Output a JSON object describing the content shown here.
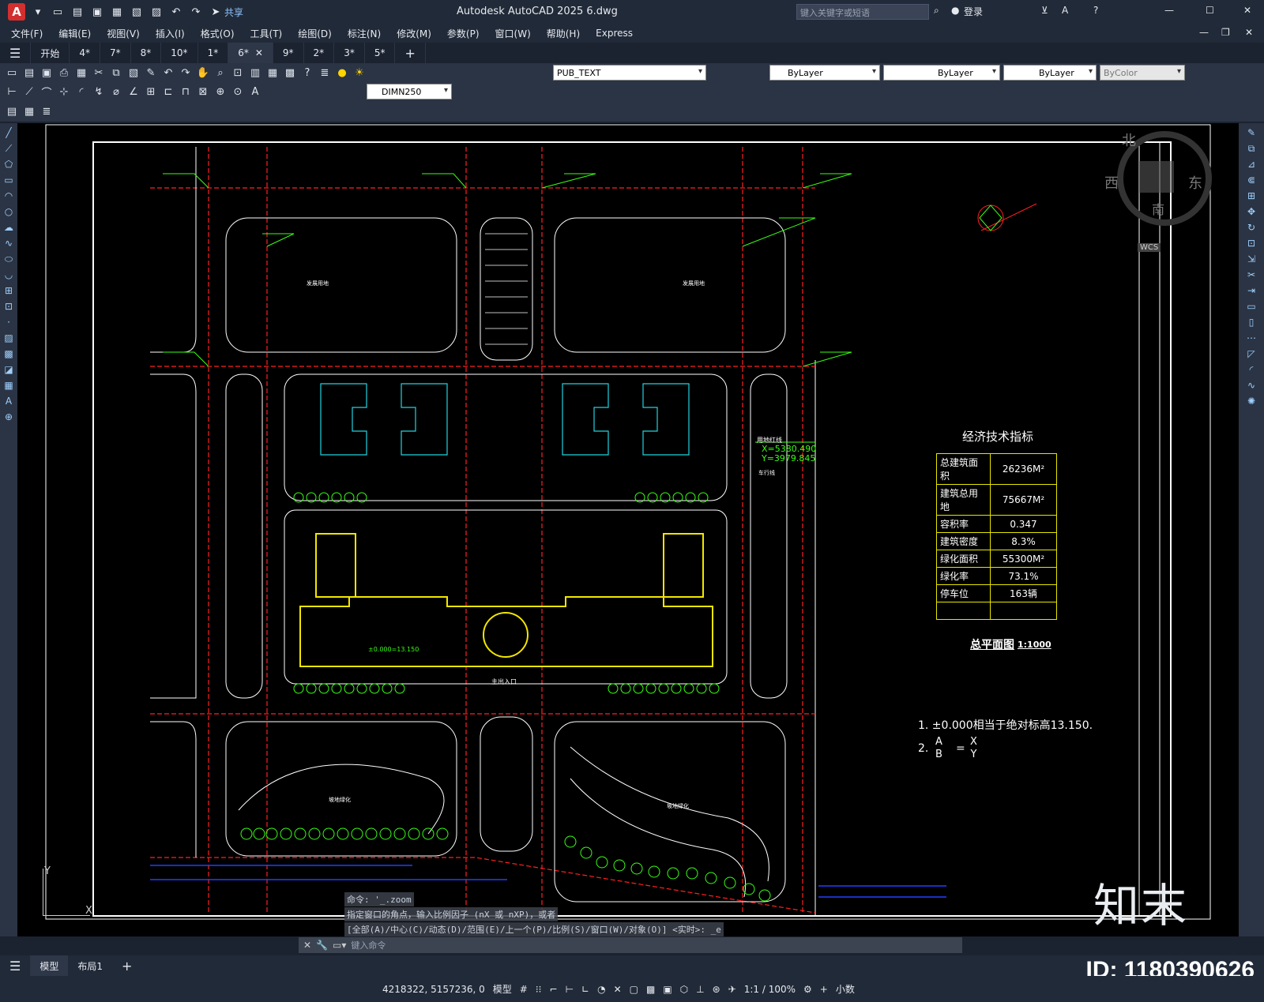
{
  "titlebar": {
    "logo": "A",
    "share": "共享",
    "title": "Autodesk AutoCAD 2025    6.dwg",
    "search_placeholder": "键入关键字或短语",
    "login": "登录"
  },
  "menu": [
    "文件(F)",
    "编辑(E)",
    "视图(V)",
    "插入(I)",
    "格式(O)",
    "工具(T)",
    "绘图(D)",
    "标注(N)",
    "修改(M)",
    "参数(P)",
    "窗口(W)",
    "帮助(H)",
    "Express"
  ],
  "tabs": [
    "开始",
    "4*",
    "7*",
    "8*",
    "10*",
    "1*",
    "6*",
    "9*",
    "2*",
    "3*",
    "5*"
  ],
  "active_tab": "6*",
  "toolbar1": {
    "layer": "PUB_TEXT",
    "color": "ByLayer",
    "linetype": "ByLayer",
    "lineweight": "ByLayer",
    "plotstyle": "ByColor"
  },
  "toolbar2": {
    "dimstyle": "DIMN250"
  },
  "drawing": {
    "compass": {
      "north": "北",
      "south": "南",
      "east": "东",
      "west": "西",
      "wcs": "WCS"
    },
    "table_title": "经济技术指标",
    "indicators": [
      {
        "label": "总建筑面积",
        "value": "26236M²"
      },
      {
        "label": "建筑总用地",
        "value": "75667M²"
      },
      {
        "label": "容积率",
        "value": "0.347"
      },
      {
        "label": "建筑密度",
        "value": "8.3%"
      },
      {
        "label": "绿化面积",
        "value": "55300M²"
      },
      {
        "label": "绿化率",
        "value": "73.1%"
      },
      {
        "label": "停车位",
        "value": "163辆"
      },
      {
        "label": "",
        "value": ""
      }
    ],
    "plan_title": "总平面图",
    "plan_scale": "1:1000",
    "note1": "1. ±0.000相当于绝对标高13.150.",
    "note2_prefix": "2.",
    "labels": {
      "reserve_land_1": "发展用地",
      "reserve_land_2": "发展用地",
      "main_entrance": "主出入口",
      "slope_green_1": "坡地绿化",
      "slope_green_2": "坡地绿化",
      "land_red_line": "用地红线",
      "coord_x": "X=5380.490",
      "coord_y": "Y=3979.845",
      "elev": "±0.000=13.150",
      "car_road": "车行线"
    }
  },
  "command": {
    "lines": [
      "命令: '_.zoom",
      "指定窗口的角点，输入比例因子 (nX 或 nXP)，或者",
      "[全部(A)/中心(C)/动态(D)/范围(E)/上一个(P)/比例(S)/窗口(W)/对象(O)] <实时>: _e"
    ],
    "placeholder": "键入命令"
  },
  "layout_tabs": [
    "模型",
    "布局1"
  ],
  "status": {
    "coords": "4218322, 5157236, 0",
    "model": "模型",
    "scale": "1:1 / 100%",
    "units": "小数"
  },
  "watermark": {
    "logo": "知末",
    "id": "ID: 1180390626"
  }
}
